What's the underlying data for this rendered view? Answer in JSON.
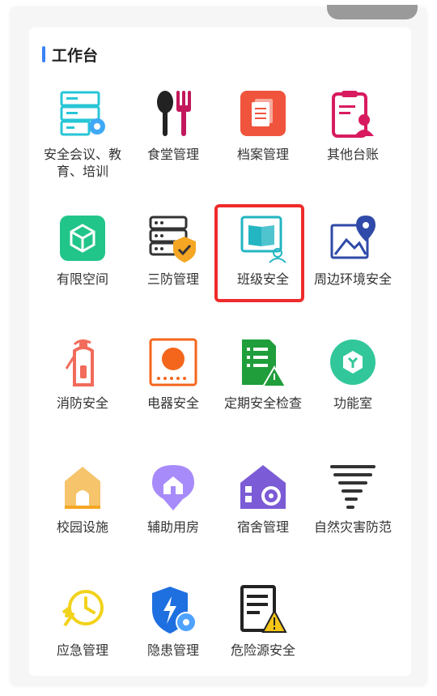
{
  "section": {
    "title": "工作台",
    "accent_color": "#3b82f6"
  },
  "highlight_color": "#ef2b2b",
  "items": [
    {
      "label": "安全会议、教育、培训",
      "icon": "server-gear-icon"
    },
    {
      "label": "食堂管理",
      "icon": "spoon-fork-icon"
    },
    {
      "label": "档案管理",
      "icon": "archive-document-icon"
    },
    {
      "label": "其他台账",
      "icon": "clipboard-user-icon"
    },
    {
      "label": "有限空间",
      "icon": "cube-icon"
    },
    {
      "label": "三防管理",
      "icon": "server-shield-icon"
    },
    {
      "label": "班级安全",
      "icon": "book-classroom-icon"
    },
    {
      "label": "周边环境安全",
      "icon": "map-pin-icon"
    },
    {
      "label": "消防安全",
      "icon": "fire-extinguisher-icon"
    },
    {
      "label": "电器安全",
      "icon": "stove-appliance-icon"
    },
    {
      "label": "定期安全检查",
      "icon": "checklist-warning-icon"
    },
    {
      "label": "功能室",
      "icon": "hexagon-function-icon"
    },
    {
      "label": "校园设施",
      "icon": "school-gate-icon"
    },
    {
      "label": "辅助用房",
      "icon": "house-pin-icon"
    },
    {
      "label": "宿舍管理",
      "icon": "dorm-gear-icon"
    },
    {
      "label": "自然灾害防范",
      "icon": "tornado-icon"
    },
    {
      "label": "应急管理",
      "icon": "clock-alarm-icon"
    },
    {
      "label": "隐患管理",
      "icon": "shield-bolt-gear-icon"
    },
    {
      "label": "危险源安全",
      "icon": "document-warning-icon"
    }
  ]
}
